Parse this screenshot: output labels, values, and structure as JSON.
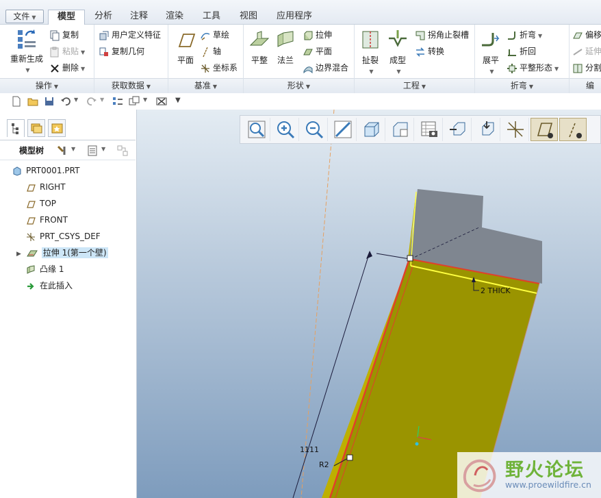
{
  "tabs": [
    {
      "label": "文件",
      "active": false
    },
    {
      "label": "模型",
      "active": true
    },
    {
      "label": "分析",
      "active": false
    },
    {
      "label": "注释",
      "active": false
    },
    {
      "label": "渲染",
      "active": false
    },
    {
      "label": "工具",
      "active": false
    },
    {
      "label": "视图",
      "active": false
    },
    {
      "label": "应用程序",
      "active": false
    }
  ],
  "ribbon": {
    "operations": {
      "regenerate": "重新生成",
      "copy": "复制",
      "paste": "粘贴",
      "delete": "删除",
      "footer": "操作"
    },
    "get_data": {
      "udf": "用户定义特征",
      "copy_geometry": "复制几何",
      "footer": "获取数据"
    },
    "datum": {
      "plane": "平面",
      "sketch": "草绘",
      "axis": "轴",
      "csys": "坐标系",
      "footer": "基准"
    },
    "shapes": {
      "flat": "平整",
      "flange": "法兰",
      "extrude": "拉伸",
      "planar": "平面",
      "blend": "边界混合",
      "footer": "形状"
    },
    "engineering": {
      "rip": "扯裂",
      "form": "成型",
      "corner_relief": "拐角止裂槽",
      "convert": "转换",
      "footer": "工程"
    },
    "bend": {
      "unbend": "展平",
      "bend": "折弯",
      "bend_back": "折回",
      "flat_pattern": "平整形态",
      "footer": "折弯"
    },
    "editing": {
      "offset": "偏移",
      "extend": "延伸",
      "split": "分割",
      "footer": "编辑"
    }
  },
  "tree": {
    "title": "模型树",
    "items": [
      {
        "label": "PRT0001.PRT",
        "icon": "part-icon"
      },
      {
        "label": "RIGHT",
        "icon": "datum-plane-icon"
      },
      {
        "label": "TOP",
        "icon": "datum-plane-icon"
      },
      {
        "label": "FRONT",
        "icon": "datum-plane-icon"
      },
      {
        "label": "PRT_CSYS_DEF",
        "icon": "csys-icon"
      },
      {
        "label": "拉伸 1(第一个壁)",
        "icon": "extrude-wall-icon",
        "selected": true
      },
      {
        "label": "凸缘 1",
        "icon": "flange-icon"
      },
      {
        "label": "在此插入",
        "icon": "insert-arrow-icon"
      }
    ]
  },
  "viewport": {
    "thick_label": "2 THICK",
    "dimension_length": "1111",
    "dimension_radius": "R2",
    "model_color": "#9a9400",
    "edge_color": "#e0402a"
  },
  "watermark": {
    "title": "野火论坛",
    "url": "www.proewildfire.cn"
  }
}
